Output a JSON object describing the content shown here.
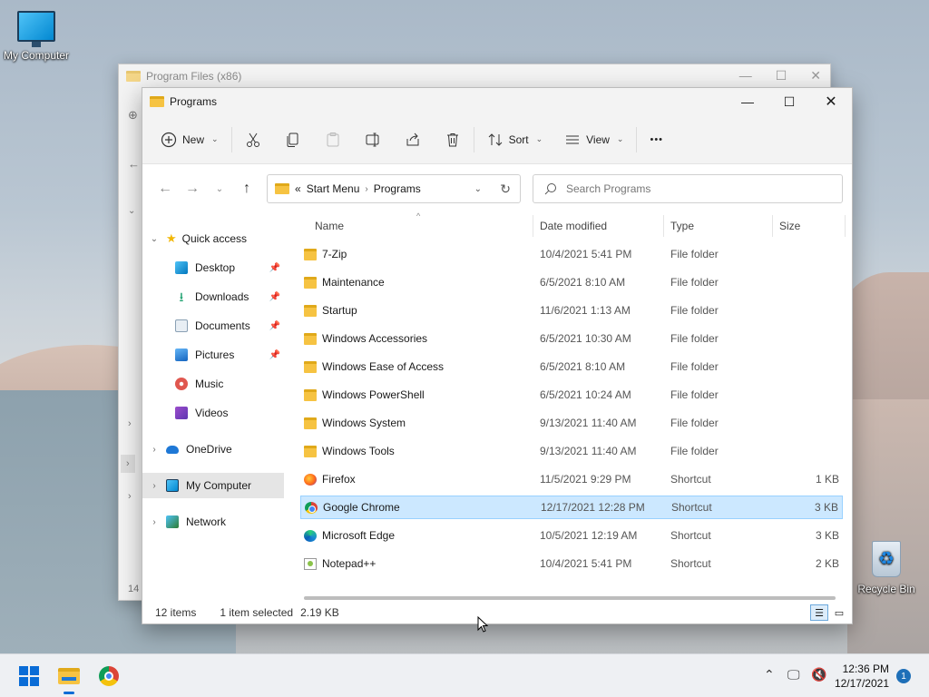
{
  "desktop": {
    "my_computer_label": "My Computer",
    "recycle_bin_label": "Recycle Bin"
  },
  "background_window": {
    "title": "Program Files (x86)",
    "partial_number": "14"
  },
  "window": {
    "title": "Programs",
    "toolbar": {
      "new_label": "New",
      "sort_label": "Sort",
      "view_label": "View",
      "more_label": "•••"
    },
    "address": {
      "prefix": "«",
      "segments": [
        "Start Menu",
        "Programs"
      ]
    },
    "search_placeholder": "Search Programs",
    "nav": {
      "quick_access": "Quick access",
      "items": [
        "Desktop",
        "Downloads",
        "Documents",
        "Pictures",
        "Music",
        "Videos"
      ],
      "onedrive": "OneDrive",
      "my_computer": "My Computer",
      "network": "Network"
    },
    "columns": {
      "name": "Name",
      "date": "Date modified",
      "type": "Type",
      "size": "Size"
    },
    "files": [
      {
        "name": "7-Zip",
        "date": "10/4/2021 5:41 PM",
        "type": "File folder",
        "size": "",
        "icon": "folder"
      },
      {
        "name": "Maintenance",
        "date": "6/5/2021 8:10 AM",
        "type": "File folder",
        "size": "",
        "icon": "folder"
      },
      {
        "name": "Startup",
        "date": "11/6/2021 1:13 AM",
        "type": "File folder",
        "size": "",
        "icon": "folder"
      },
      {
        "name": "Windows Accessories",
        "date": "6/5/2021 10:30 AM",
        "type": "File folder",
        "size": "",
        "icon": "folder"
      },
      {
        "name": "Windows Ease of Access",
        "date": "6/5/2021 8:10 AM",
        "type": "File folder",
        "size": "",
        "icon": "folder"
      },
      {
        "name": "Windows PowerShell",
        "date": "6/5/2021 10:24 AM",
        "type": "File folder",
        "size": "",
        "icon": "folder"
      },
      {
        "name": "Windows System",
        "date": "9/13/2021 11:40 AM",
        "type": "File folder",
        "size": "",
        "icon": "folder"
      },
      {
        "name": "Windows Tools",
        "date": "9/13/2021 11:40 AM",
        "type": "File folder",
        "size": "",
        "icon": "folder"
      },
      {
        "name": "Firefox",
        "date": "11/5/2021 9:29 PM",
        "type": "Shortcut",
        "size": "1 KB",
        "icon": "firefox"
      },
      {
        "name": "Google Chrome",
        "date": "12/17/2021 12:28 PM",
        "type": "Shortcut",
        "size": "3 KB",
        "icon": "chrome",
        "selected": true
      },
      {
        "name": "Microsoft Edge",
        "date": "10/5/2021 12:19 AM",
        "type": "Shortcut",
        "size": "3 KB",
        "icon": "edge"
      },
      {
        "name": "Notepad++",
        "date": "10/4/2021 5:41 PM",
        "type": "Shortcut",
        "size": "2 KB",
        "icon": "notepadpp"
      }
    ],
    "status": {
      "items_count": "12 items",
      "selection": "1 item selected",
      "selection_size": "2.19 KB"
    }
  },
  "taskbar": {
    "time": "12:36 PM",
    "date": "12/17/2021",
    "notification_count": "1"
  },
  "colors": {
    "accent": "#0a6cd6",
    "selection_bg": "#cce8ff",
    "folder": "#f6c342"
  }
}
